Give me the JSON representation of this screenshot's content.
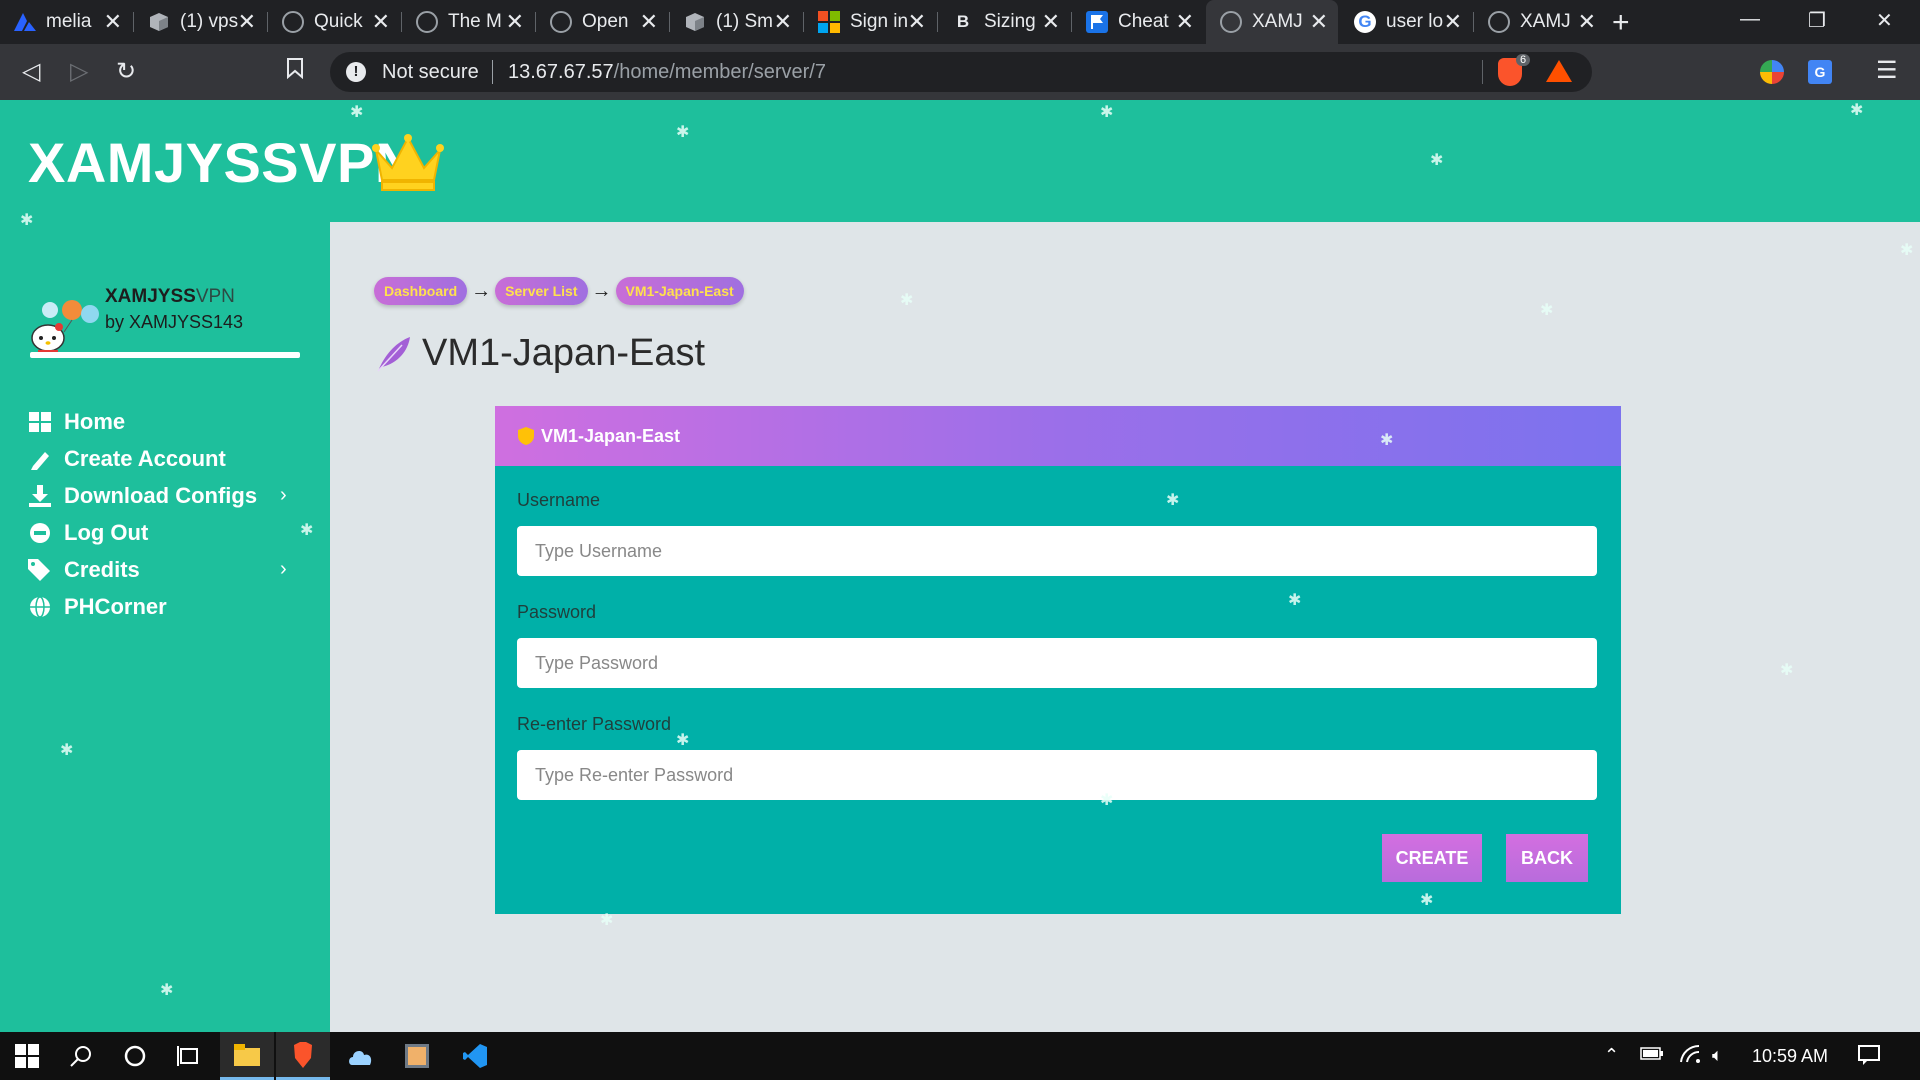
{
  "browser": {
    "tabs": [
      {
        "title": "melia",
        "favicon": "melia-icon",
        "active": false
      },
      {
        "title": "(1) vps",
        "favicon": "box-icon",
        "active": false
      },
      {
        "title": "Quick",
        "favicon": "globe-icon",
        "active": false
      },
      {
        "title": "The M",
        "favicon": "globe-icon",
        "active": false
      },
      {
        "title": "Open",
        "favicon": "globe-icon",
        "active": false
      },
      {
        "title": "(1) Sm",
        "favicon": "box-icon",
        "active": false
      },
      {
        "title": "Sign in",
        "favicon": "microsoft-icon",
        "active": false
      },
      {
        "title": "Sizing",
        "favicon": "bootstrap-icon",
        "active": false
      },
      {
        "title": "Cheat",
        "favicon": "flag-icon",
        "active": false
      },
      {
        "title": "XAMJ",
        "favicon": "globe-icon",
        "active": true
      },
      {
        "title": "user lo",
        "favicon": "google-icon",
        "active": false
      },
      {
        "title": "XAMJ",
        "favicon": "globe-icon",
        "active": false
      }
    ],
    "new_tab": "+",
    "window": {
      "minimize": "—",
      "restore": "❐",
      "close": "✕"
    },
    "security_label": "Not secure",
    "url_host": "13.67.67.57",
    "url_path": "/home/member/server/7",
    "brave_badge": "6"
  },
  "header": {
    "brand": "XAMJYSSVPN"
  },
  "sidebar": {
    "user_name_bold": "XAMJYSS",
    "user_name_light": "VPN",
    "user_sub": "by XAMJYSS143",
    "items": [
      {
        "label": "Home",
        "icon": "grid-icon",
        "has_children": false
      },
      {
        "label": "Create Account",
        "icon": "pencil-icon",
        "has_children": false
      },
      {
        "label": "Download Configs",
        "icon": "download-icon",
        "has_children": true
      },
      {
        "label": "Log Out",
        "icon": "minus-circle-icon",
        "has_children": false
      },
      {
        "label": "Credits",
        "icon": "tags-icon",
        "has_children": true
      },
      {
        "label": "PHCorner",
        "icon": "globe-icon",
        "has_children": false
      }
    ]
  },
  "breadcrumb": [
    "Dashboard",
    "Server List",
    "VM1-Japan-East"
  ],
  "breadcrumb_separator": "→",
  "page_title": "VM1-Japan-East",
  "card": {
    "title": "VM1-Japan-East",
    "fields": [
      {
        "label": "Username",
        "placeholder": "Type Username",
        "value": ""
      },
      {
        "label": "Password",
        "placeholder": "Type Password",
        "value": ""
      },
      {
        "label": "Re-enter Password",
        "placeholder": "Type Re-enter Password",
        "value": ""
      }
    ],
    "create_label": "CREATE",
    "back_label": "BACK"
  },
  "taskbar": {
    "clock": "10:59 AM"
  },
  "colors": {
    "page_bg": "#1ebf9c",
    "content_bg": "#dfe5e8",
    "card_bg": "#00b0a8",
    "card_header_start": "#cf6fe0",
    "card_header_end": "#7c72ee",
    "button": "#c86dd7",
    "crumb_text": "#ffe14d"
  }
}
